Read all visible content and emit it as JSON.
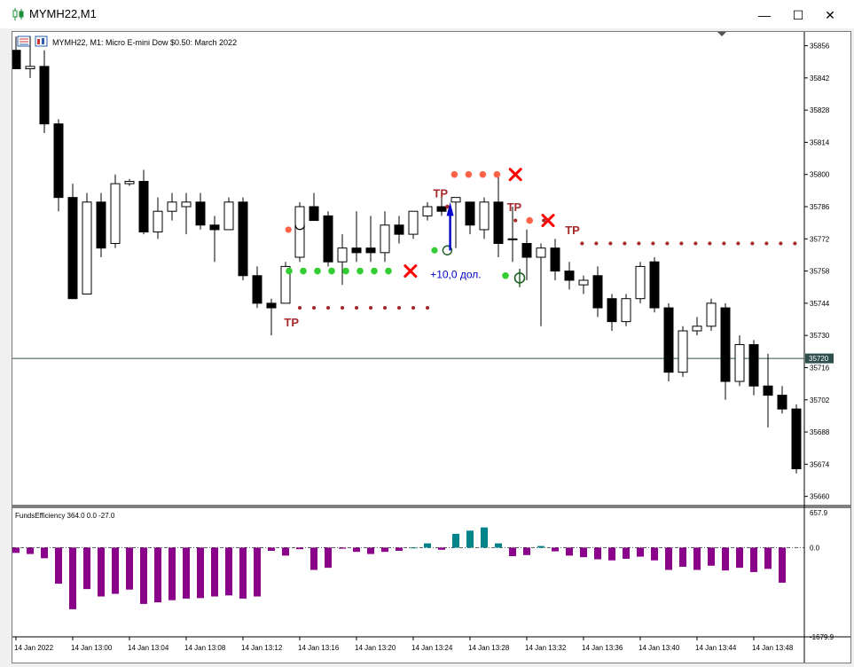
{
  "window": {
    "title": "MYMH22,M1",
    "controls": {
      "minimize": "—",
      "maximize": "☐",
      "close": "✕"
    }
  },
  "chart_header": {
    "text": "MYMH22, M1:  Micro E-mini Dow $0.50: March 2022"
  },
  "price_axis": {
    "labels": [
      "35856",
      "35842",
      "35828",
      "35814",
      "35800",
      "35786",
      "35772",
      "35758",
      "35744",
      "35730",
      "35716",
      "35702",
      "35688",
      "35674",
      "35660"
    ],
    "current_price": "35720"
  },
  "time_axis": {
    "labels": [
      "14 Jan 2022",
      "14 Jan 13:00",
      "14 Jan 13:04",
      "14 Jan 13:08",
      "14 Jan 13:12",
      "14 Jan 13:16",
      "14 Jan 13:20",
      "14 Jan 13:24",
      "14 Jan 13:28",
      "14 Jan 13:32",
      "14 Jan 13:36",
      "14 Jan 13:40",
      "14 Jan 13:44",
      "14 Jan 13:48"
    ]
  },
  "annotations": {
    "tp_label": "TP",
    "profit_label": "+10,0 дол."
  },
  "indicator": {
    "header": "FundsEfficiency 364.0 0.0 -27.0",
    "axis_labels": [
      "657.9",
      "0.0",
      "-1679.9"
    ]
  },
  "colors": {
    "bull_body": "#ffffff",
    "bear_body": "#000000",
    "positive_histogram": "#00848c",
    "negative_histogram": "#8b008b",
    "tp_text": "#a52a2a",
    "red_dots": "#ff6347",
    "green_dots": "#32cd32",
    "brown_dots": "#a52a2a",
    "close_cross": "#ff0000",
    "profit_text": "#0000cd",
    "current_price_label_bg": "#2f4f4f"
  },
  "chart_data": [
    {
      "type": "candlestick",
      "title": "MYMH22, M1:  Micro E-mini Dow $0.50: March 2022",
      "ylim": [
        35656,
        35862
      ],
      "candles": [
        {
          "t": "12:56",
          "o": 35854,
          "h": 35860,
          "l": 35846,
          "c": 35846
        },
        {
          "t": "12:57",
          "o": 35846,
          "h": 35860,
          "l": 35842,
          "c": 35847
        },
        {
          "t": "12:58",
          "o": 35847,
          "h": 35854,
          "l": 35818,
          "c": 35822
        },
        {
          "t": "12:59",
          "o": 35822,
          "h": 35824,
          "l": 35784,
          "c": 35790
        },
        {
          "t": "13:00",
          "o": 35790,
          "h": 35796,
          "l": 35746,
          "c": 35746
        },
        {
          "t": "13:01",
          "o": 35748,
          "h": 35792,
          "l": 35748,
          "c": 35788
        },
        {
          "t": "13:02",
          "o": 35788,
          "h": 35792,
          "l": 35764,
          "c": 35768
        },
        {
          "t": "13:03",
          "o": 35770,
          "h": 35800,
          "l": 35768,
          "c": 35796
        },
        {
          "t": "13:04",
          "o": 35796,
          "h": 35798,
          "l": 35795,
          "c": 35797
        },
        {
          "t": "13:05",
          "o": 35797,
          "h": 35802,
          "l": 35774,
          "c": 35775
        },
        {
          "t": "13:06",
          "o": 35775,
          "h": 35790,
          "l": 35772,
          "c": 35784
        },
        {
          "t": "13:07",
          "o": 35784,
          "h": 35792,
          "l": 35780,
          "c": 35788
        },
        {
          "t": "13:08",
          "o": 35786,
          "h": 35792,
          "l": 35774,
          "c": 35788
        },
        {
          "t": "13:09",
          "o": 35788,
          "h": 35792,
          "l": 35776,
          "c": 35778
        },
        {
          "t": "13:10",
          "o": 35778,
          "h": 35782,
          "l": 35762,
          "c": 35776
        },
        {
          "t": "13:11",
          "o": 35776,
          "h": 35790,
          "l": 35776,
          "c": 35788
        },
        {
          "t": "13:12",
          "o": 35788,
          "h": 35790,
          "l": 35754,
          "c": 35756
        },
        {
          "t": "13:13",
          "o": 35756,
          "h": 35760,
          "l": 35742,
          "c": 35744
        },
        {
          "t": "13:14",
          "o": 35744,
          "h": 35746,
          "l": 35730,
          "c": 35742
        },
        {
          "t": "13:15",
          "o": 35744,
          "h": 35762,
          "l": 35744,
          "c": 35760
        },
        {
          "t": "13:16",
          "o": 35764,
          "h": 35788,
          "l": 35762,
          "c": 35786
        },
        {
          "t": "13:17",
          "o": 35786,
          "h": 35792,
          "l": 35782,
          "c": 35780
        },
        {
          "t": "13:18",
          "o": 35782,
          "h": 35784,
          "l": 35760,
          "c": 35762
        },
        {
          "t": "13:19",
          "o": 35762,
          "h": 35774,
          "l": 35752,
          "c": 35768
        },
        {
          "t": "13:20",
          "o": 35768,
          "h": 35784,
          "l": 35762,
          "c": 35766
        },
        {
          "t": "13:21",
          "o": 35768,
          "h": 35782,
          "l": 35762,
          "c": 35766
        },
        {
          "t": "13:22",
          "o": 35766,
          "h": 35784,
          "l": 35762,
          "c": 35778
        },
        {
          "t": "13:23",
          "o": 35778,
          "h": 35782,
          "l": 35770,
          "c": 35774
        },
        {
          "t": "13:24",
          "o": 35774,
          "h": 35784,
          "l": 35772,
          "c": 35784
        },
        {
          "t": "13:25",
          "o": 35782,
          "h": 35788,
          "l": 35780,
          "c": 35786
        },
        {
          "t": "13:26",
          "o": 35786,
          "h": 35790,
          "l": 35782,
          "c": 35784
        },
        {
          "t": "13:27",
          "o": 35788,
          "h": 35790,
          "l": 35768,
          "c": 35790
        },
        {
          "t": "13:28",
          "o": 35788,
          "h": 35788,
          "l": 35774,
          "c": 35778
        },
        {
          "t": "13:29",
          "o": 35776,
          "h": 35790,
          "l": 35772,
          "c": 35788
        },
        {
          "t": "13:30",
          "o": 35788,
          "h": 35800,
          "l": 35764,
          "c": 35770
        },
        {
          "t": "13:31",
          "o": 35772,
          "h": 35786,
          "l": 35762,
          "c": 35772
        },
        {
          "t": "13:32",
          "o": 35770,
          "h": 35776,
          "l": 35754,
          "c": 35764
        },
        {
          "t": "13:33",
          "o": 35764,
          "h": 35770,
          "l": 35734,
          "c": 35768
        },
        {
          "t": "13:34",
          "o": 35768,
          "h": 35772,
          "l": 35754,
          "c": 35758
        },
        {
          "t": "13:35",
          "o": 35758,
          "h": 35762,
          "l": 35750,
          "c": 35754
        },
        {
          "t": "13:36",
          "o": 35752,
          "h": 35756,
          "l": 35748,
          "c": 35754
        },
        {
          "t": "13:37",
          "o": 35756,
          "h": 35760,
          "l": 35738,
          "c": 35742
        },
        {
          "t": "13:38",
          "o": 35746,
          "h": 35748,
          "l": 35732,
          "c": 35736
        },
        {
          "t": "13:39",
          "o": 35736,
          "h": 35748,
          "l": 35734,
          "c": 35746
        },
        {
          "t": "13:40",
          "o": 35746,
          "h": 35762,
          "l": 35744,
          "c": 35760
        },
        {
          "t": "13:41",
          "o": 35762,
          "h": 35764,
          "l": 35740,
          "c": 35742
        },
        {
          "t": "13:42",
          "o": 35742,
          "h": 35744,
          "l": 35710,
          "c": 35714
        },
        {
          "t": "13:43",
          "o": 35714,
          "h": 35734,
          "l": 35712,
          "c": 35732
        },
        {
          "t": "13:44",
          "o": 35732,
          "h": 35738,
          "l": 35730,
          "c": 35734
        },
        {
          "t": "13:45",
          "o": 35734,
          "h": 35746,
          "l": 35732,
          "c": 35744
        },
        {
          "t": "13:46",
          "o": 35742,
          "h": 35744,
          "l": 35702,
          "c": 35710
        },
        {
          "t": "13:47",
          "o": 35710,
          "h": 35730,
          "l": 35708,
          "c": 35726
        },
        {
          "t": "13:48",
          "o": 35726,
          "h": 35728,
          "l": 35704,
          "c": 35708
        },
        {
          "t": "13:49",
          "o": 35708,
          "h": 35722,
          "l": 35690,
          "c": 35704
        },
        {
          "t": "13:50",
          "o": 35704,
          "h": 35708,
          "l": 35696,
          "c": 35698
        },
        {
          "t": "13:51",
          "o": 35698,
          "h": 35700,
          "l": 35670,
          "c": 35672
        }
      ],
      "current_price": 35720
    },
    {
      "type": "bar",
      "title": "FundsEfficiency 364.0 0.0 -27.0",
      "ylim": [
        -1679.9,
        657.9
      ],
      "values": [
        -100,
        -120,
        -200,
        -680,
        -1160,
        -780,
        -920,
        -870,
        -790,
        -1060,
        -1030,
        -990,
        -960,
        -950,
        -920,
        -900,
        -960,
        -920,
        -60,
        -150,
        -30,
        -420,
        -380,
        -20,
        -80,
        -120,
        -80,
        -60,
        0,
        80,
        -40,
        260,
        320,
        380,
        80,
        -160,
        -140,
        30,
        -70,
        -150,
        -180,
        -220,
        -240,
        -210,
        -170,
        -240,
        -420,
        -360,
        -420,
        -340,
        -430,
        -380,
        -460,
        -400,
        -660
      ]
    }
  ]
}
